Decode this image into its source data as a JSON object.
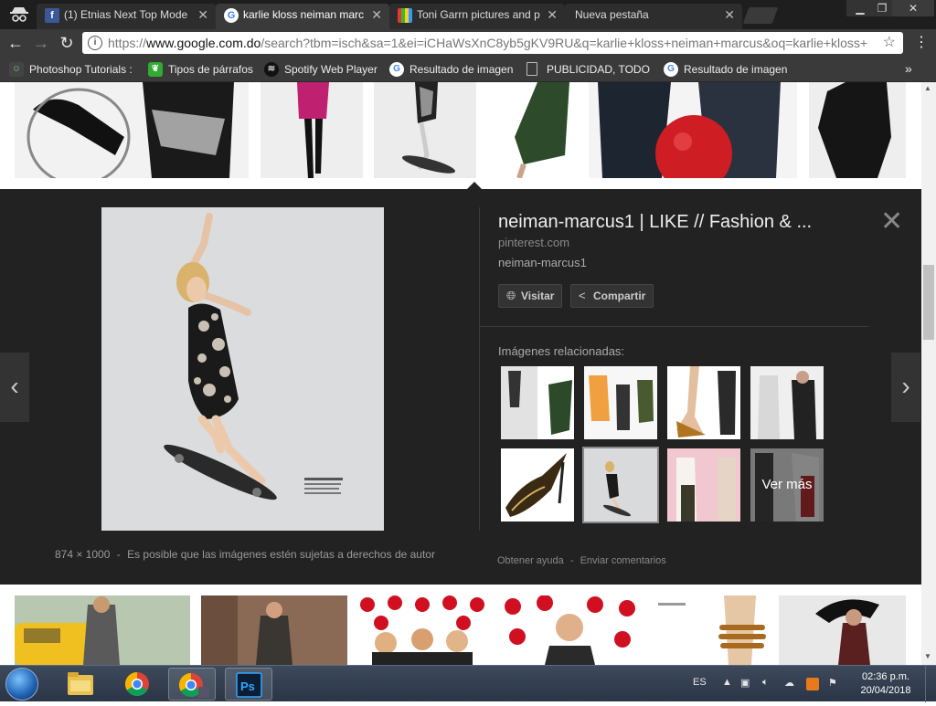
{
  "tabs": [
    {
      "title": "(1) Etnias Next Top Mode",
      "icon": "facebook-icon"
    },
    {
      "title": "karlie kloss neiman marc",
      "icon": "google-icon",
      "active": true
    },
    {
      "title": "Toni Garrn pictures and p",
      "icon": "books-icon"
    },
    {
      "title": "Nueva pestaña",
      "icon": "none"
    }
  ],
  "address": {
    "prefix": "https://",
    "domain": "www.google.com.do",
    "path": "/search?tbm=isch&sa=1&ei=iCHaWsXnC8yb5gKV9RU&q=karlie+kloss+neiman+marcus&oq=karlie+kloss+"
  },
  "bookmarks": [
    {
      "label": "Photoshop Tutorials :",
      "icon": "photoshop-bookmark-icon"
    },
    {
      "label": "Tipos de párrafos",
      "icon": "leaf-icon"
    },
    {
      "label": "Spotify Web Player",
      "icon": "spotify-icon"
    },
    {
      "label": "Resultado de imagen",
      "icon": "google-icon"
    },
    {
      "label": "PUBLICIDAD, TODO S",
      "icon": "page-icon"
    },
    {
      "label": "Resultado de imagen",
      "icon": "google-icon"
    }
  ],
  "panel": {
    "title": "neiman-marcus1 | LIKE // Fashion & ...",
    "domain": "pinterest.com",
    "subtitle": "neiman-marcus1",
    "visit_label": "Visitar",
    "share_label": "Compartir",
    "related_label": "Imágenes relacionadas:",
    "more_label": "Ver más",
    "dimensions": "874 × 1000",
    "copyright_note": "Es posible que las imágenes estén sujetas a derechos de autor",
    "help_label": "Obtener ayuda",
    "feedback_label": "Enviar comentarios",
    "separator": "-"
  },
  "taskbar": {
    "language": "ES",
    "time": "02:36 p.m.",
    "date": "20/04/2018"
  },
  "colors": {
    "panel_bg": "#222222",
    "chrome_bg": "#3a3a3a",
    "tabstrip_bg": "#1e1e1e"
  }
}
